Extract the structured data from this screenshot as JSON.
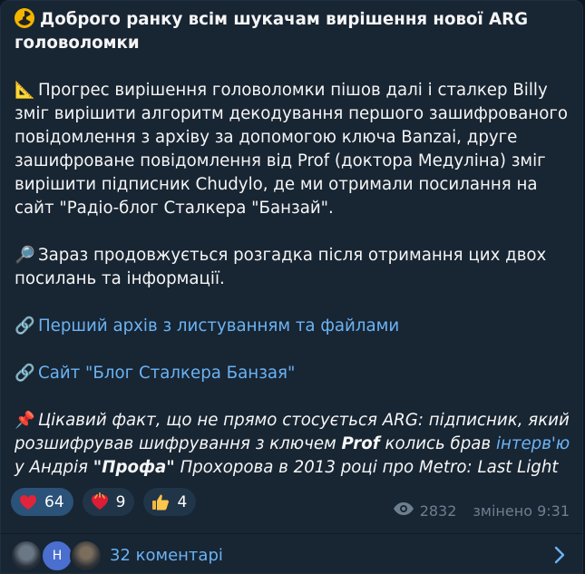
{
  "post": {
    "title": "Доброго ранку всім шукачам вирішення нової ARG головоломки",
    "para1_emoji": "📐",
    "para1": "Прогрес вирішення головоломки пішов далі і сталкер Billy зміг вирішити алгоритм декодування першого зашифрованого повідомлення з архіву за допомогою ключа Banzai, друге зашифроване повідомлення від Prof (доктора Медуліна) зміг вирішити підписник Chudylo, де ми отримали посилання на сайт \"Радіо-блог Сталкера \"Банзай\".",
    "para2_emoji": "🔎",
    "para2": "Зараз продовжується розгадка після отримання цих двох посилань та інформації.",
    "link1_emoji": "🔗",
    "link1": "Перший архів з листуванням та файлами",
    "link2_emoji": "🔗",
    "link2": "Сайт \"Блог Сталкера Банзая\"",
    "fact_emoji": "📌",
    "fact_part1": "Цікавий факт, що не прямо стосується ARG: підписник, який розшифрував шифрування з ключем ",
    "fact_bold1": "Prof",
    "fact_part2": " колись брав ",
    "fact_link": "інтерв'ю",
    "fact_part3": " у Андрія ",
    "fact_bold2": "\"Профа\"",
    "fact_part4": " Прохорова в 2013 році про Metro: Last Light"
  },
  "reactions": [
    {
      "icon": "heart-icon",
      "count": "64"
    },
    {
      "icon": "burning-heart-icon",
      "count": "9"
    },
    {
      "icon": "thumbs-up-icon",
      "count": "4"
    }
  ],
  "meta": {
    "views": "2832",
    "edited": "змінено 9:31"
  },
  "comments": {
    "avatar_letter": "Н",
    "label": "32 коментарі"
  },
  "colors": {
    "link": "#6ab3f3",
    "bubble": "#182533",
    "reaction_active": "#2b5278"
  }
}
